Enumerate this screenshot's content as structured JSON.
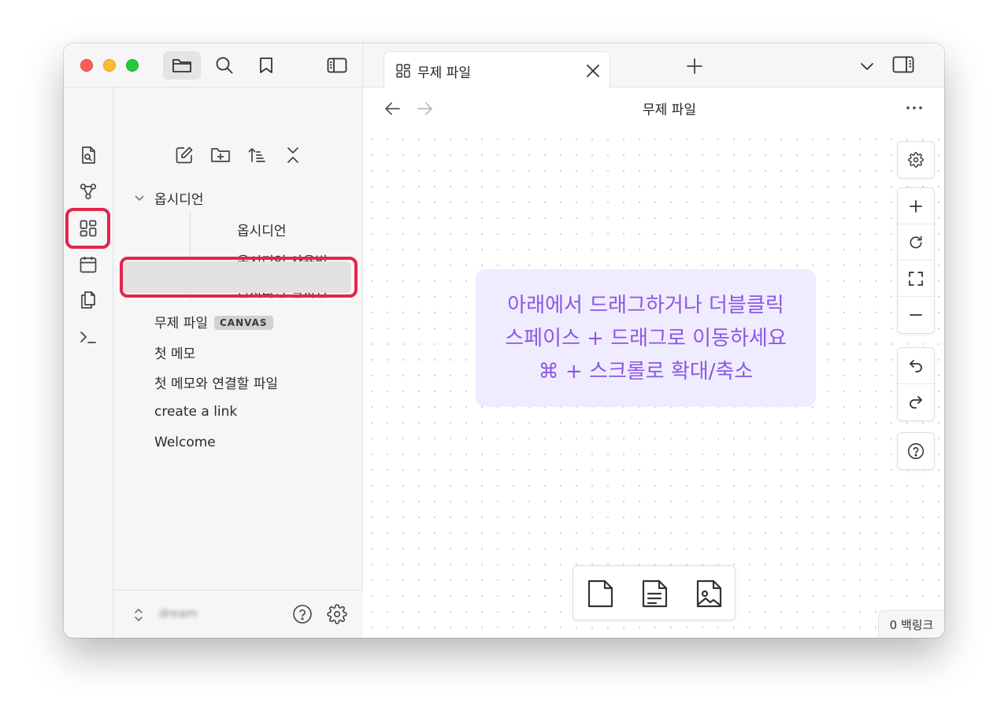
{
  "titlebar": {
    "traffic_lights": [
      "close",
      "minimize",
      "zoom"
    ],
    "tools": [
      "files-icon",
      "search-icon",
      "bookmark-icon",
      "sidebar-toggle-icon"
    ]
  },
  "ribbon": {
    "items": [
      "quick-switcher-icon",
      "graph-icon",
      "canvas-icon",
      "calendar-icon",
      "templates-icon",
      "terminal-icon"
    ],
    "highlighted": "canvas-icon"
  },
  "explorer": {
    "tools": [
      "new-note-icon",
      "new-folder-icon",
      "sort-icon",
      "collapse-all-icon"
    ],
    "folder": {
      "label": "옵시디언",
      "expanded": true,
      "children": [
        "옵시디언",
        "옵시디언 사용법",
        "옵시디언 설치법"
      ]
    },
    "files": [
      {
        "label": "무제 파일",
        "badge": "CANVAS",
        "selected": true
      },
      {
        "label": "첫 메모"
      },
      {
        "label": "첫 메모와 연결할 파일"
      },
      {
        "label": "create a link"
      },
      {
        "label": "Welcome"
      }
    ],
    "footer": {
      "vault_name": "dream"
    }
  },
  "tabs": [
    {
      "label": "무제 파일",
      "active": true
    }
  ],
  "view": {
    "title": "무제 파일",
    "canvas_hint": {
      "line1": "아래에서 드래그하거나 더블클릭",
      "line2": "스페이스 + 드래그로 이동하세요",
      "line3": "⌘ + 스크롤로 확대/축소"
    }
  },
  "status": {
    "backlinks": "0 백링크"
  },
  "colors": {
    "accent": "#8a57e6",
    "highlight": "#e2264d",
    "card_bg": "#f0ecff"
  }
}
